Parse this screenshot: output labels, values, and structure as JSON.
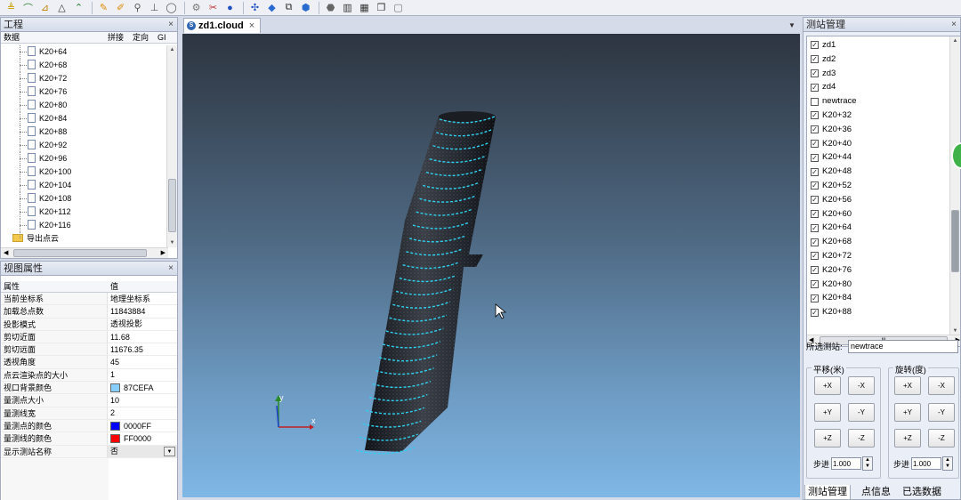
{
  "toolbar": {
    "icons": [
      "level-icon",
      "profile-icon",
      "angle-icon",
      "triangle-icon",
      "peak-icon",
      "pencil-icon",
      "ruler-icon",
      "probe-icon",
      "crop-icon",
      "zoom-icon",
      "gear-icon",
      "record-icon",
      "color-icon",
      "network-icon",
      "cone-icon",
      "copy-icon",
      "sphere-icon",
      "mesh-icon",
      "layout-1-icon",
      "layout-2-icon",
      "window-icon",
      "blank-icon"
    ],
    "glyphs": [
      "≜",
      "⌒",
      "⊿",
      "△",
      "⌃",
      "✎",
      "✐",
      "⚲",
      "⊥",
      "◯",
      "⚙",
      "✂",
      "●",
      "✣",
      "◆",
      "⧉",
      "⬢",
      "⬣",
      "▥",
      "▦",
      "❐",
      "▢"
    ]
  },
  "project": {
    "title": "工程",
    "close": "×",
    "columns": [
      "数据",
      "拼接",
      "定向",
      "GI"
    ],
    "items": [
      "K20+64",
      "K20+68",
      "K20+72",
      "K20+76",
      "K20+80",
      "K20+84",
      "K20+88",
      "K20+92",
      "K20+96",
      "K20+100",
      "K20+104",
      "K20+108",
      "K20+112",
      "K20+116"
    ],
    "export_label": "导出点云"
  },
  "view_props": {
    "title": "视图属性",
    "close": "×",
    "header_key": "属性",
    "header_value": "值",
    "rows": [
      {
        "k": "当前坐标系",
        "v": "地理坐标系"
      },
      {
        "k": "加载总点数",
        "v": "11843884"
      },
      {
        "k": "投影模式",
        "v": "透视投影"
      },
      {
        "k": "剪切近面",
        "v": "11.68"
      },
      {
        "k": "剪切远面",
        "v": "11676.35"
      },
      {
        "k": "透视角度",
        "v": "45"
      },
      {
        "k": "点云渲染点的大小",
        "v": "1"
      },
      {
        "k": "视口背景颜色",
        "v": "87CEFA",
        "color": "#87CEFA"
      },
      {
        "k": "量测点大小",
        "v": "10"
      },
      {
        "k": "量测线宽",
        "v": "2"
      },
      {
        "k": "量测点的颜色",
        "v": "0000FF",
        "color": "#0000FF"
      },
      {
        "k": "量测线的颜色",
        "v": "FF0000",
        "color": "#FF0000"
      },
      {
        "k": "显示测站名称",
        "v": "否",
        "dropdown": true
      }
    ]
  },
  "doc_tab": {
    "label": "zd1.cloud",
    "icon": "cloud-file-icon",
    "close": "×"
  },
  "viewport": {
    "axis_x": "x",
    "axis_y": "y",
    "accent": "#2fd0f0",
    "bg_top": "#2d3540",
    "bg_bottom": "#7fb7e5"
  },
  "stations": {
    "title": "测站管理",
    "close": "×",
    "items": [
      {
        "name": "zd1",
        "checked": true
      },
      {
        "name": "zd2",
        "checked": true
      },
      {
        "name": "zd3",
        "checked": true
      },
      {
        "name": "zd4",
        "checked": true
      },
      {
        "name": "newtrace",
        "checked": false
      },
      {
        "name": "K20+32",
        "checked": true
      },
      {
        "name": "K20+36",
        "checked": true
      },
      {
        "name": "K20+40",
        "checked": true
      },
      {
        "name": "K20+44",
        "checked": true
      },
      {
        "name": "K20+48",
        "checked": true
      },
      {
        "name": "K20+52",
        "checked": true
      },
      {
        "name": "K20+56",
        "checked": true
      },
      {
        "name": "K20+60",
        "checked": true
      },
      {
        "name": "K20+64",
        "checked": true
      },
      {
        "name": "K20+68",
        "checked": true
      },
      {
        "name": "K20+72",
        "checked": true
      },
      {
        "name": "K20+76",
        "checked": true
      },
      {
        "name": "K20+80",
        "checked": true
      },
      {
        "name": "K20+84",
        "checked": true
      },
      {
        "name": "K20+88",
        "checked": true
      }
    ],
    "hscroll_grip": "III",
    "selected_label": "所选测站:",
    "selected_value": "newtrace",
    "translate": {
      "title": "平移(米)",
      "buttons": [
        "+X",
        "-X",
        "+Y",
        "-Y",
        "+Z",
        "-Z"
      ],
      "step_label": "步进",
      "step_value": "1.000"
    },
    "rotate": {
      "title": "旋转(度)",
      "buttons": [
        "+X",
        "-X",
        "+Y",
        "-Y",
        "+Z",
        "-Z"
      ],
      "step_label": "步进",
      "step_value": "1.000"
    },
    "bottom_tabs": [
      "测站管理",
      "点信息",
      "已选数据"
    ]
  }
}
